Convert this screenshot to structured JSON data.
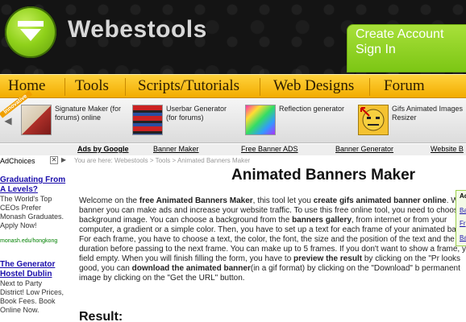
{
  "header": {
    "logo_text": "Webestools",
    "account_line1": "Create Account",
    "account_line2": "Sign In"
  },
  "nav": [
    "Home",
    "Tools",
    "Scripts/Tutorials",
    "Web Designs",
    "Forum"
  ],
  "ribbon_text": "Innovative",
  "tools": [
    {
      "label": "Signature Maker (for forums) online"
    },
    {
      "label": "Userbar Generator (for forums)"
    },
    {
      "label": "Reflection generator"
    },
    {
      "label": "Gifs Animated Images Resizer"
    }
  ],
  "ads_bar": {
    "ads_by": "Ads by Google",
    "links": [
      "Banner Maker",
      "Free Banner ADS",
      "Banner Generator",
      "Website B"
    ]
  },
  "left_ads": {
    "adchoices": "AdChoices",
    "items": [
      {
        "title": "Graduating From A Levels?",
        "body": "The World's Top CEOs Prefer Monash Graduates. Apply Now!",
        "url": "monash.edu/hongkong"
      },
      {
        "title": "The Generator Hostel Dublin",
        "body": "Next to Party District! Low Prices, Book Fees. Book Online Now."
      }
    ]
  },
  "breadcrumb": "You are here: Webestools > Tools > Animated Banners Maker",
  "page_title": "Animated Banners Maker",
  "intro": {
    "p1": "Welcome on the ",
    "b1": "free Animated Banners Maker",
    "p2": ", this tool let you ",
    "b2": "create gifs animated banner online",
    "p3": ". With a banner you can make ads and increase your website traffic. To use this free online tool, you need to choose a background image. You can choose a background from the ",
    "b3": "banners gallery",
    "p4": ", from internet or from your computer, a gradient or a simple color. Then, you have to set up a text for each frame of your animated banner. For each frame, you have to choose a text, the color, the font, the size and the position of the text and the frame duration before passing to the next frame. You can make up to 5 frames. If you don't want to show a frame, you field empty. When you will finish filling the form, you have to ",
    "b4": "preview the result",
    "p5": " by clicking on the \"Pr looks good, you can ",
    "b5": "download the animated banner",
    "p6": "(in a gif format) by clicking on the \"Download\" b permanent image by clicking on the \"Get the URL\" button."
  },
  "result_title": "Result:",
  "right_box": [
    "Ac",
    "Ba",
    "Fr",
    "Ba"
  ]
}
